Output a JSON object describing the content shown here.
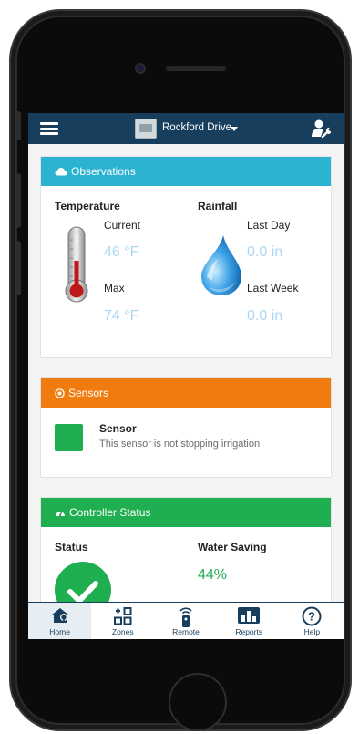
{
  "header": {
    "title": "Rockford Drive"
  },
  "observations": {
    "title": "Observations",
    "temperature": {
      "heading": "Temperature",
      "current_label": "Current",
      "current_value": "46 °F",
      "max_label": "Max",
      "max_value": "74 °F"
    },
    "rainfall": {
      "heading": "Rainfall",
      "last_day_label": "Last Day",
      "last_day_value": "0.0 in",
      "last_week_label": "Last Week",
      "last_week_value": "0.0 in"
    }
  },
  "sensors": {
    "title": "Sensors",
    "sensor_name": "Sensor",
    "sensor_description": "This sensor is not stopping irrigation"
  },
  "controller_status": {
    "title": "Controller Status",
    "status_label": "Status",
    "water_saving_label": "Water Saving",
    "water_saving_value": "44%"
  },
  "nav": {
    "items": [
      {
        "label": "Home",
        "icon": "home-icon",
        "active": true
      },
      {
        "label": "Zones",
        "icon": "zones-icon",
        "active": false
      },
      {
        "label": "Remote",
        "icon": "remote-icon",
        "active": false
      },
      {
        "label": "Reports",
        "icon": "reports-icon",
        "active": false
      },
      {
        "label": "Help",
        "icon": "help-icon",
        "active": false
      }
    ]
  },
  "colors": {
    "header_bg": "#173e5c",
    "observations": "#2bb3d1",
    "sensors": "#f07c10",
    "controller_status": "#1fae50",
    "value_text": "#a9d7f3"
  }
}
